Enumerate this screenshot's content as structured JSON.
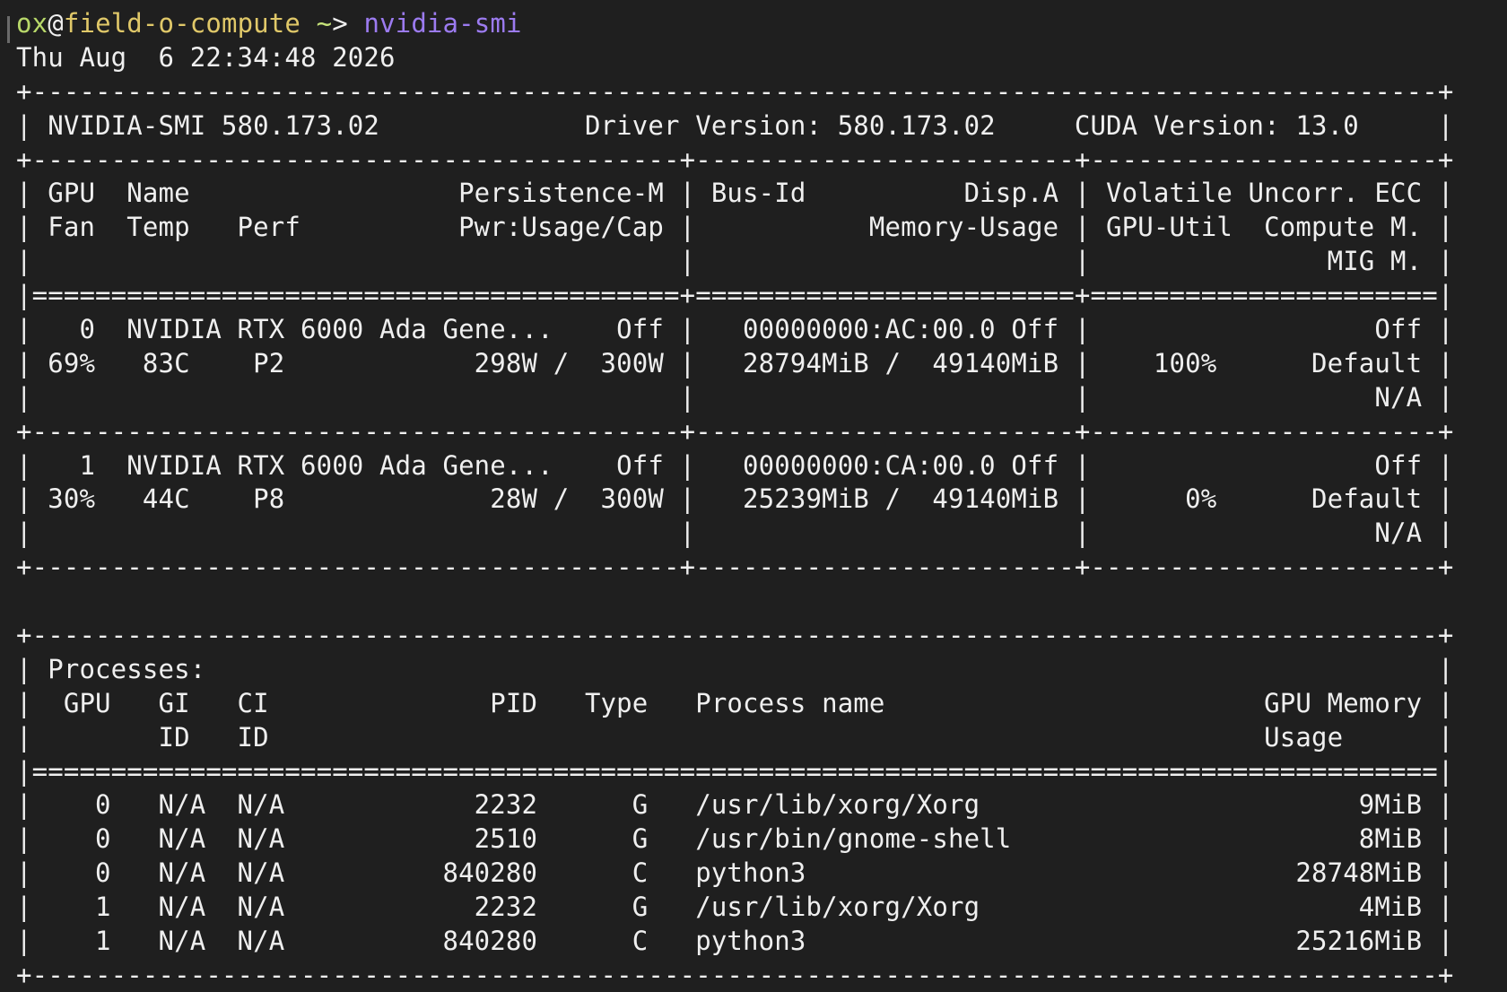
{
  "prompt": {
    "user": "ox",
    "at": "@",
    "host": "field-o-compute",
    "path": " ~",
    "arrow": "> ",
    "command": "nvidia-smi"
  },
  "timestamp": "Thu Aug  6 22:34:48 2026",
  "lines": [
    "+-----------------------------------------------------------------------------------------+",
    "| NVIDIA-SMI 580.173.02             Driver Version: 580.173.02     CUDA Version: 13.0     |",
    "+-----------------------------------------+------------------------+----------------------+",
    "| GPU  Name                 Persistence-M | Bus-Id          Disp.A | Volatile Uncorr. ECC |",
    "| Fan  Temp   Perf          Pwr:Usage/Cap |           Memory-Usage | GPU-Util  Compute M. |",
    "|                                         |                        |               MIG M. |",
    "|=========================================+========================+======================|",
    "|   0  NVIDIA RTX 6000 Ada Gene...    Off |   00000000:AC:00.0 Off |                  Off |",
    "| 69%   83C    P2            298W /  300W |   28794MiB /  49140MiB |    100%      Default |",
    "|                                         |                        |                  N/A |",
    "+-----------------------------------------+------------------------+----------------------+",
    "|   1  NVIDIA RTX 6000 Ada Gene...    Off |   00000000:CA:00.0 Off |                  Off |",
    "| 30%   44C    P8             28W /  300W |   25239MiB /  49140MiB |      0%      Default |",
    "|                                         |                        |                  N/A |",
    "+-----------------------------------------+------------------------+----------------------+",
    "",
    "+-----------------------------------------------------------------------------------------+",
    "| Processes:                                                                              |",
    "|  GPU   GI   CI              PID   Type   Process name                        GPU Memory |",
    "|        ID   ID                                                               Usage      |",
    "|=========================================================================================|",
    "|    0   N/A  N/A            2232      G   /usr/lib/xorg/Xorg                        9MiB |",
    "|    0   N/A  N/A            2510      G   /usr/bin/gnome-shell                      8MiB |",
    "|    0   N/A  N/A          840280      C   python3                               28748MiB |",
    "|    1   N/A  N/A            2232      G   /usr/lib/xorg/Xorg                        4MiB |",
    "|    1   N/A  N/A          840280      C   python3                               25216MiB |",
    "+-----------------------------------------------------------------------------------------+"
  ]
}
